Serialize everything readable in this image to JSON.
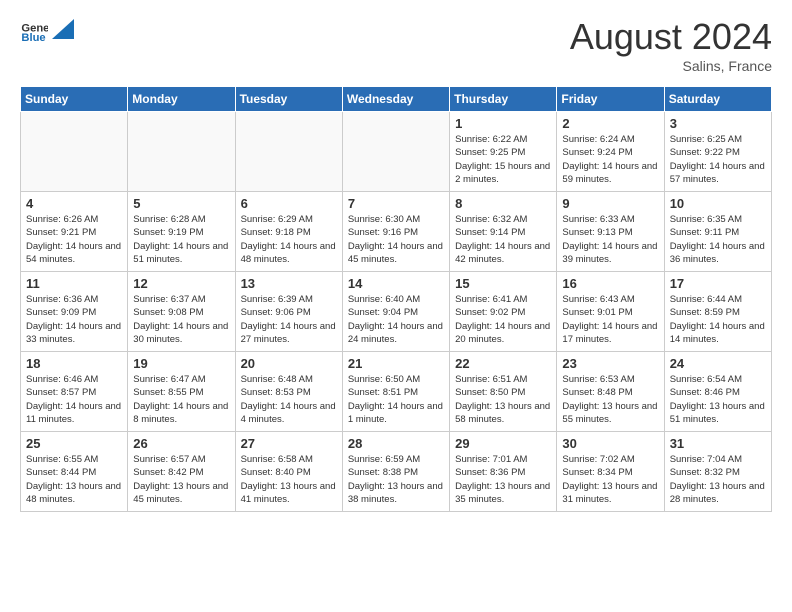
{
  "header": {
    "logo_general": "General",
    "logo_blue": "Blue",
    "month_year": "August 2024",
    "location": "Salins, France"
  },
  "days_of_week": [
    "Sunday",
    "Monday",
    "Tuesday",
    "Wednesday",
    "Thursday",
    "Friday",
    "Saturday"
  ],
  "weeks": [
    [
      {
        "day": "",
        "info": ""
      },
      {
        "day": "",
        "info": ""
      },
      {
        "day": "",
        "info": ""
      },
      {
        "day": "",
        "info": ""
      },
      {
        "day": "1",
        "info": "Sunrise: 6:22 AM\nSunset: 9:25 PM\nDaylight: 15 hours\nand 2 minutes."
      },
      {
        "day": "2",
        "info": "Sunrise: 6:24 AM\nSunset: 9:24 PM\nDaylight: 14 hours\nand 59 minutes."
      },
      {
        "day": "3",
        "info": "Sunrise: 6:25 AM\nSunset: 9:22 PM\nDaylight: 14 hours\nand 57 minutes."
      }
    ],
    [
      {
        "day": "4",
        "info": "Sunrise: 6:26 AM\nSunset: 9:21 PM\nDaylight: 14 hours\nand 54 minutes."
      },
      {
        "day": "5",
        "info": "Sunrise: 6:28 AM\nSunset: 9:19 PM\nDaylight: 14 hours\nand 51 minutes."
      },
      {
        "day": "6",
        "info": "Sunrise: 6:29 AM\nSunset: 9:18 PM\nDaylight: 14 hours\nand 48 minutes."
      },
      {
        "day": "7",
        "info": "Sunrise: 6:30 AM\nSunset: 9:16 PM\nDaylight: 14 hours\nand 45 minutes."
      },
      {
        "day": "8",
        "info": "Sunrise: 6:32 AM\nSunset: 9:14 PM\nDaylight: 14 hours\nand 42 minutes."
      },
      {
        "day": "9",
        "info": "Sunrise: 6:33 AM\nSunset: 9:13 PM\nDaylight: 14 hours\nand 39 minutes."
      },
      {
        "day": "10",
        "info": "Sunrise: 6:35 AM\nSunset: 9:11 PM\nDaylight: 14 hours\nand 36 minutes."
      }
    ],
    [
      {
        "day": "11",
        "info": "Sunrise: 6:36 AM\nSunset: 9:09 PM\nDaylight: 14 hours\nand 33 minutes."
      },
      {
        "day": "12",
        "info": "Sunrise: 6:37 AM\nSunset: 9:08 PM\nDaylight: 14 hours\nand 30 minutes."
      },
      {
        "day": "13",
        "info": "Sunrise: 6:39 AM\nSunset: 9:06 PM\nDaylight: 14 hours\nand 27 minutes."
      },
      {
        "day": "14",
        "info": "Sunrise: 6:40 AM\nSunset: 9:04 PM\nDaylight: 14 hours\nand 24 minutes."
      },
      {
        "day": "15",
        "info": "Sunrise: 6:41 AM\nSunset: 9:02 PM\nDaylight: 14 hours\nand 20 minutes."
      },
      {
        "day": "16",
        "info": "Sunrise: 6:43 AM\nSunset: 9:01 PM\nDaylight: 14 hours\nand 17 minutes."
      },
      {
        "day": "17",
        "info": "Sunrise: 6:44 AM\nSunset: 8:59 PM\nDaylight: 14 hours\nand 14 minutes."
      }
    ],
    [
      {
        "day": "18",
        "info": "Sunrise: 6:46 AM\nSunset: 8:57 PM\nDaylight: 14 hours\nand 11 minutes."
      },
      {
        "day": "19",
        "info": "Sunrise: 6:47 AM\nSunset: 8:55 PM\nDaylight: 14 hours\nand 8 minutes."
      },
      {
        "day": "20",
        "info": "Sunrise: 6:48 AM\nSunset: 8:53 PM\nDaylight: 14 hours\nand 4 minutes."
      },
      {
        "day": "21",
        "info": "Sunrise: 6:50 AM\nSunset: 8:51 PM\nDaylight: 14 hours\nand 1 minute."
      },
      {
        "day": "22",
        "info": "Sunrise: 6:51 AM\nSunset: 8:50 PM\nDaylight: 13 hours\nand 58 minutes."
      },
      {
        "day": "23",
        "info": "Sunrise: 6:53 AM\nSunset: 8:48 PM\nDaylight: 13 hours\nand 55 minutes."
      },
      {
        "day": "24",
        "info": "Sunrise: 6:54 AM\nSunset: 8:46 PM\nDaylight: 13 hours\nand 51 minutes."
      }
    ],
    [
      {
        "day": "25",
        "info": "Sunrise: 6:55 AM\nSunset: 8:44 PM\nDaylight: 13 hours\nand 48 minutes."
      },
      {
        "day": "26",
        "info": "Sunrise: 6:57 AM\nSunset: 8:42 PM\nDaylight: 13 hours\nand 45 minutes."
      },
      {
        "day": "27",
        "info": "Sunrise: 6:58 AM\nSunset: 8:40 PM\nDaylight: 13 hours\nand 41 minutes."
      },
      {
        "day": "28",
        "info": "Sunrise: 6:59 AM\nSunset: 8:38 PM\nDaylight: 13 hours\nand 38 minutes."
      },
      {
        "day": "29",
        "info": "Sunrise: 7:01 AM\nSunset: 8:36 PM\nDaylight: 13 hours\nand 35 minutes."
      },
      {
        "day": "30",
        "info": "Sunrise: 7:02 AM\nSunset: 8:34 PM\nDaylight: 13 hours\nand 31 minutes."
      },
      {
        "day": "31",
        "info": "Sunrise: 7:04 AM\nSunset: 8:32 PM\nDaylight: 13 hours\nand 28 minutes."
      }
    ]
  ]
}
